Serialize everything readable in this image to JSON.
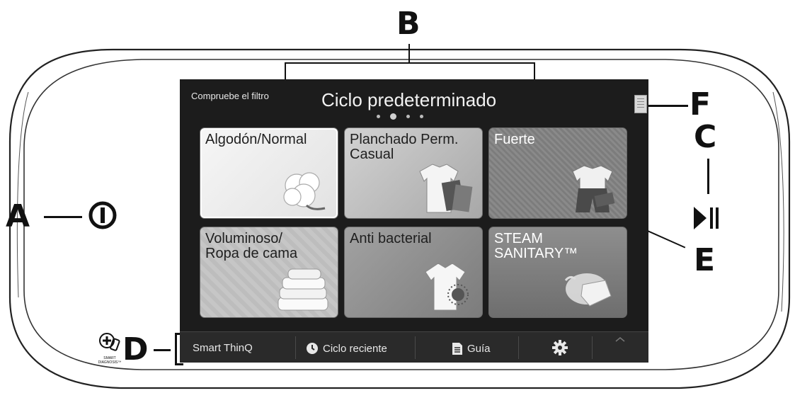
{
  "callouts": {
    "a": "A",
    "b": "B",
    "c": "C",
    "d": "D",
    "e": "E",
    "f": "F"
  },
  "screen": {
    "header_left": "Compruebe el filtro",
    "title": "Ciclo predeterminado",
    "page_dots": {
      "count": 4,
      "active": 2
    }
  },
  "tiles": [
    {
      "label": "Algodón/Normal",
      "icon": "cotton-icon"
    },
    {
      "label": "Planchado Perm.\nCasual",
      "icon": "shirt-icon"
    },
    {
      "label": "Fuerte",
      "icon": "workwear-icon"
    },
    {
      "label": "Voluminoso/\nRopa de cama",
      "icon": "bedding-icon"
    },
    {
      "label": "Anti bacterial",
      "icon": "tshirt-germ-icon"
    },
    {
      "label": "STEAM\nSANITARY™",
      "icon": "steam-cloth-icon"
    }
  ],
  "bottom_bar": {
    "smart_thinq": "Smart ThinQ",
    "recent_cycle": "Ciclo reciente",
    "guide": "Guía"
  },
  "icons": {
    "power": "power-icon",
    "play_pause": "play-pause-icon",
    "smart_diagnosis": "smart-diagnosis-icon",
    "settings": "gear-icon",
    "menu": "menu-icon"
  },
  "smart_diagnosis_caption": "SMART DIAGNOSIS™"
}
